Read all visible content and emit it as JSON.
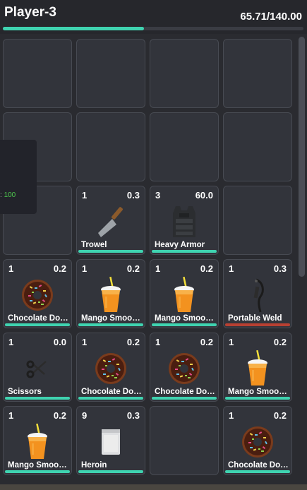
{
  "player": {
    "name": "Player-3",
    "weight": "65.71/140.00",
    "weight_fraction": 0.4694
  },
  "tooltip": {
    "prefix": ":",
    "value": "100"
  },
  "slots": [
    {
      "empty": true
    },
    {
      "empty": true
    },
    {
      "empty": true
    },
    {
      "empty": true
    },
    {
      "empty": true
    },
    {
      "empty": true
    },
    {
      "empty": true
    },
    {
      "empty": true
    },
    {
      "empty": true
    },
    {
      "qty": "1",
      "weight": "0.3",
      "label": "Trowel",
      "icon": "trowel-icon",
      "durability_color": "#3fd3b0"
    },
    {
      "qty": "3",
      "weight": "60.0",
      "label": "Heavy Armor",
      "icon": "armor-icon",
      "durability_color": "#3fd3b0"
    },
    {
      "empty": true
    },
    {
      "qty": "1",
      "weight": "0.2",
      "label": "Chocolate Donut",
      "icon": "donut-icon",
      "durability_color": "#3fd3b0"
    },
    {
      "qty": "1",
      "weight": "0.2",
      "label": "Mango Smoothie",
      "icon": "smoothie-icon",
      "durability_color": "#3fd3b0"
    },
    {
      "qty": "1",
      "weight": "0.2",
      "label": "Mango Smoothie",
      "icon": "smoothie-icon",
      "durability_color": "#3fd3b0"
    },
    {
      "qty": "1",
      "weight": "0.3",
      "label": "Portable Weld",
      "icon": "weld-icon",
      "durability_color": "#b84032"
    },
    {
      "qty": "1",
      "weight": "0.0",
      "label": "Scissors",
      "icon": "scissors-icon",
      "durability_color": "#3fd3b0"
    },
    {
      "qty": "1",
      "weight": "0.2",
      "label": "Chocolate Donut",
      "icon": "donut-icon",
      "durability_color": "#3fd3b0"
    },
    {
      "qty": "1",
      "weight": "0.2",
      "label": "Chocolate Donut",
      "icon": "donut-icon",
      "durability_color": "#3fd3b0"
    },
    {
      "qty": "1",
      "weight": "0.2",
      "label": "Mango Smoothie",
      "icon": "smoothie-icon",
      "durability_color": "#3fd3b0"
    },
    {
      "qty": "1",
      "weight": "0.2",
      "label": "Mango Smoothie",
      "icon": "smoothie-icon",
      "durability_color": "#3fd3b0"
    },
    {
      "qty": "9",
      "weight": "0.3",
      "label": "Heroin",
      "icon": "heroin-bag-icon",
      "durability_color": "#3fd3b0"
    },
    {
      "empty": true
    },
    {
      "qty": "1",
      "weight": "0.2",
      "label": "Chocolate Donut",
      "icon": "donut-icon",
      "durability_color": "#3fd3b0"
    }
  ]
}
